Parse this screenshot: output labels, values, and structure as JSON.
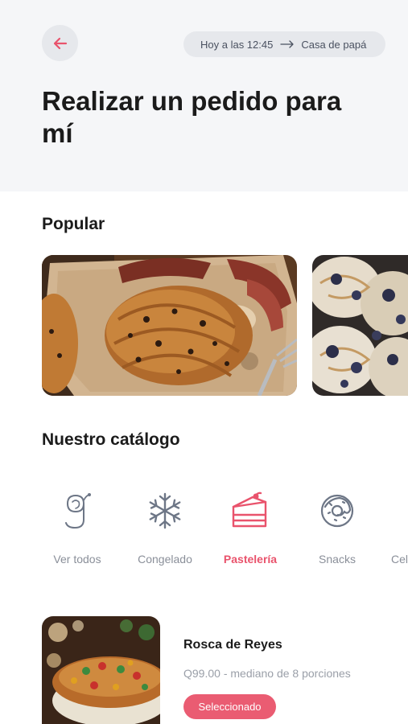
{
  "header": {
    "delivery_time": "Hoy a las 12:45",
    "delivery_place": "Casa de papá",
    "title": "Realizar un pedido para mí"
  },
  "popular": {
    "title": "Popular"
  },
  "catalog": {
    "title": "Nuestro catálogo",
    "categories": [
      {
        "label": "Ver todos",
        "icon": "g-logo-icon",
        "active": false
      },
      {
        "label": "Congelado",
        "icon": "snowflake-icon",
        "active": false
      },
      {
        "label": "Pastelería",
        "icon": "cake-slice-icon",
        "active": true
      },
      {
        "label": "Snacks",
        "icon": "donut-icon",
        "active": false
      },
      {
        "label": "Cel",
        "icon": "",
        "active": false
      }
    ]
  },
  "product": {
    "name": "Rosca de Reyes",
    "description": "Q99.00 - mediano de 8 porciones",
    "button_label": "Seleccionado"
  },
  "colors": {
    "accent": "#e9536c",
    "header_bg": "#f5f6f8",
    "pill_bg": "#e6e8ec",
    "icon_gray": "#6d7686"
  }
}
